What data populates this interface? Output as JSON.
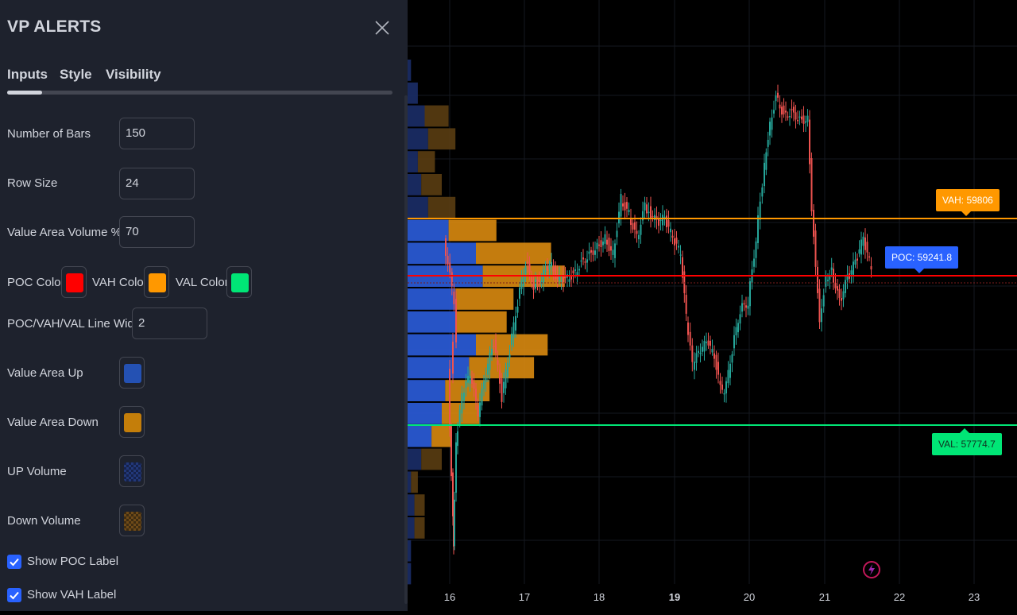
{
  "dialog": {
    "title": "VP ALERTS",
    "tabs": [
      "Inputs",
      "Style",
      "Visibility"
    ],
    "active_tab": "Inputs"
  },
  "inputs": {
    "number_of_bars": {
      "label": "Number of Bars",
      "value": "150"
    },
    "row_size": {
      "label": "Row Size",
      "value": "24"
    },
    "value_area_volume": {
      "label": "Value Area Volume %",
      "value": "70"
    },
    "poc_color": {
      "label": "POC Color",
      "color": "#ff0000"
    },
    "vah_color": {
      "label": "VAH Color",
      "color": "#ff9800"
    },
    "val_color": {
      "label": "VAL Color",
      "color": "#00e676"
    },
    "line_width": {
      "label": "POC/VAH/VAL Line Width",
      "value": "2"
    },
    "value_area_up": {
      "label": "Value Area Up",
      "color": "#2451b3"
    },
    "value_area_down": {
      "label": "Value Area Down",
      "color": "#c47e0a"
    },
    "up_volume": {
      "label": "UP Volume",
      "color": "#1b2b55"
    },
    "down_volume": {
      "label": "Down Volume",
      "color": "#553c16"
    },
    "show_poc_label": {
      "label": "Show POC Label",
      "checked": true
    },
    "show_vah_label": {
      "label": "Show VAH Label",
      "checked": true
    }
  },
  "chart": {
    "vah_label": "VAH: 59806",
    "poc_label": "POC: 59241.8",
    "val_label": "VAL: 57774.7",
    "x_ticks": [
      "16",
      "17",
      "18",
      "19",
      "20",
      "21",
      "22",
      "23"
    ],
    "bold_tick": "19",
    "colors": {
      "up": "#26a69a",
      "down": "#ef5350",
      "vah": "#ff9800",
      "poc": "#ff0000",
      "val": "#00e676",
      "poc_label_bg": "#2962ff"
    }
  },
  "chart_data": {
    "type": "candlestick-volume-profile",
    "x_ticks": [
      "16",
      "17",
      "18",
      "19",
      "20",
      "21",
      "22",
      "23"
    ],
    "levels": {
      "VAH": 59806,
      "POC": 59241.8,
      "VAL": 57774.7
    },
    "profile_rows": [
      {
        "up": 0.5,
        "down": 0.0
      },
      {
        "up": 1.5,
        "down": 0.0
      },
      {
        "up": 2.5,
        "down": 3.5
      },
      {
        "up": 3.0,
        "down": 4.0
      },
      {
        "up": 1.5,
        "down": 2.5
      },
      {
        "up": 2.0,
        "down": 3.0
      },
      {
        "up": 3.0,
        "down": 4.0
      },
      {
        "up": 6.0,
        "down": 7.0
      },
      {
        "up": 10.0,
        "down": 11.0
      },
      {
        "up": 11.0,
        "down": 12.0
      },
      {
        "up": 7.0,
        "down": 8.5
      },
      {
        "up": 7.0,
        "down": 7.5
      },
      {
        "up": 10.0,
        "down": 10.5
      },
      {
        "up": 9.0,
        "down": 9.5
      },
      {
        "up": 5.5,
        "down": 6.5
      },
      {
        "up": 5.0,
        "down": 5.5
      },
      {
        "up": 3.5,
        "down": 3.0
      },
      {
        "up": 2.0,
        "down": 3.0
      },
      {
        "up": 0.5,
        "down": 1.0
      },
      {
        "up": 1.0,
        "down": 1.5
      },
      {
        "up": 1.0,
        "down": 1.5
      },
      {
        "up": 0.5,
        "down": 0.0
      },
      {
        "up": 0.5,
        "down": 0.0
      }
    ]
  }
}
